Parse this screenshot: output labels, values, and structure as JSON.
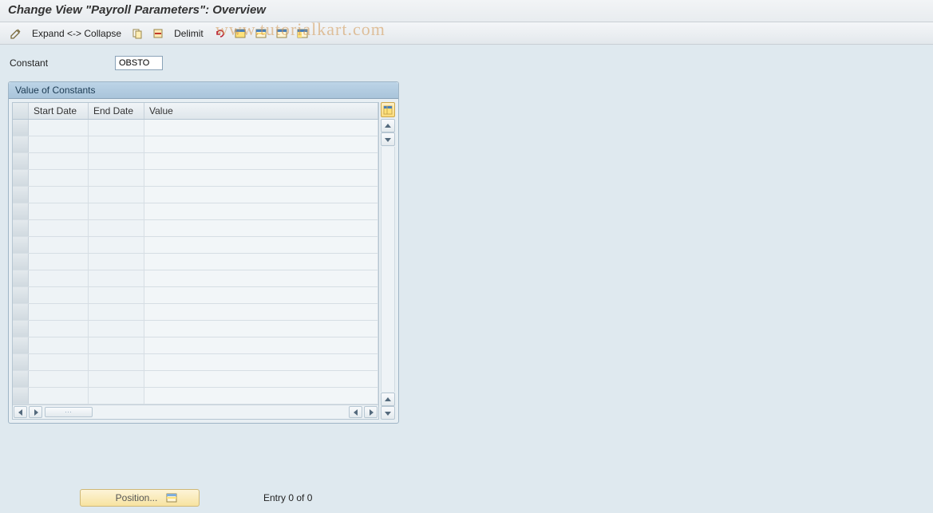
{
  "header": {
    "title": "Change View \"Payroll Parameters\": Overview"
  },
  "toolbar": {
    "expand_collapse_label": "Expand <-> Collapse",
    "delimit_label": "Delimit"
  },
  "watermark": "www.tutorialkart.com",
  "fields": {
    "constant_label": "Constant",
    "constant_value": "OBSTO"
  },
  "group": {
    "title": "Value of Constants",
    "columns": {
      "start_date": "Start Date",
      "end_date": "End Date",
      "value": "Value"
    },
    "rows": 17
  },
  "footer": {
    "position_label": "Position...",
    "entry_text": "Entry 0 of 0"
  }
}
